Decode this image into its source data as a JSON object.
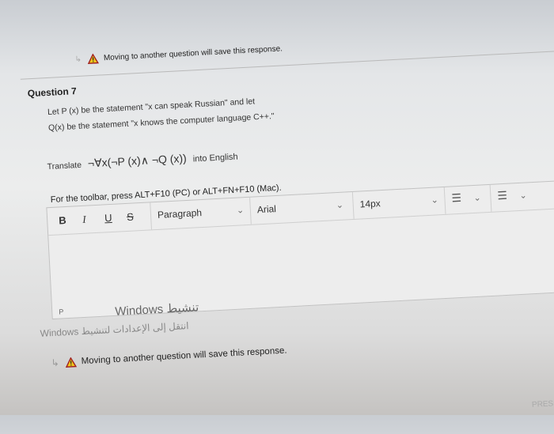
{
  "top_warning": {
    "back_arrow": "↳",
    "text": "Moving to another question will save this response."
  },
  "question": {
    "label": "Question 7",
    "line1": "Let P (x) be the statement \"x can speak Russian\" and let",
    "line2": "Q(x) be the statement \"x knows the computer language C++.\"",
    "translate_label": "Translate",
    "formula": "¬∀x(¬P (x)∧ ¬Q (x))",
    "translate_suffix": "into English"
  },
  "editor": {
    "toolbar_hint": "For the toolbar, press ALT+F10 (PC) or ALT+FN+F10 (Mac).",
    "buttons": {
      "bold": "B",
      "italic": "I",
      "underline": "U",
      "strike": "S"
    },
    "paragraph_select": "Paragraph",
    "font_select": "Arial",
    "size_select": "14px",
    "chevron": "⌄",
    "list_icon_glyph": "☰",
    "status_path": "P"
  },
  "windows_overlay": {
    "line1": "Windows تنشيط",
    "line2": "Windows انتقل إلى الإعدادات لتنشيط"
  },
  "bottom_warning": {
    "back_arrow": "↳",
    "text": "Moving to another question will save this response."
  },
  "corner_text": "PRESS",
  "colors": {
    "warning_fill": "#f0c419",
    "warning_stroke": "#a02020"
  }
}
